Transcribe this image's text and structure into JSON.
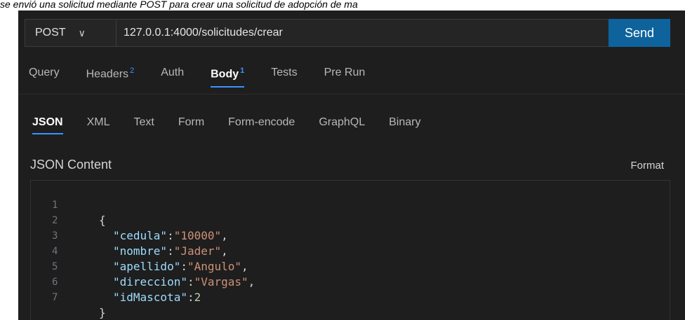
{
  "caption": "se envió una solicitud mediante POST para crear una solicitud de adopción de ma",
  "request": {
    "method": "POST",
    "url": "127.0.0.1:4000/solicitudes/crear",
    "send_label": "Send"
  },
  "tabs": [
    {
      "label": "Query",
      "badge": ""
    },
    {
      "label": "Headers",
      "badge": "2"
    },
    {
      "label": "Auth",
      "badge": ""
    },
    {
      "label": "Body",
      "badge": "1",
      "active": true
    },
    {
      "label": "Tests",
      "badge": ""
    },
    {
      "label": "Pre Run",
      "badge": ""
    }
  ],
  "body_tabs": [
    "JSON",
    "XML",
    "Text",
    "Form",
    "Form-encode",
    "GraphQL",
    "Binary"
  ],
  "content_label": "JSON Content",
  "format_label": "Format",
  "editor": {
    "lines": [
      {
        "n": "1",
        "open": "{"
      },
      {
        "n": "2",
        "key": "\"cedula\"",
        "value": "\"10000\"",
        "type": "str"
      },
      {
        "n": "3",
        "key": "\"nombre\"",
        "value": "\"Jader\"",
        "type": "str"
      },
      {
        "n": "4",
        "key": "\"apellido\"",
        "value": "\"Angulo\"",
        "type": "str"
      },
      {
        "n": "5",
        "key": "\"direccion\"",
        "value": "\"Vargas\"",
        "type": "str"
      },
      {
        "n": "6",
        "key": "\"idMascota\"",
        "value": "2",
        "type": "num"
      },
      {
        "n": "7",
        "close": "}"
      }
    ]
  },
  "colors": {
    "accent": "#3794ff",
    "send": "#0e639c",
    "background": "#1e1e1e"
  }
}
